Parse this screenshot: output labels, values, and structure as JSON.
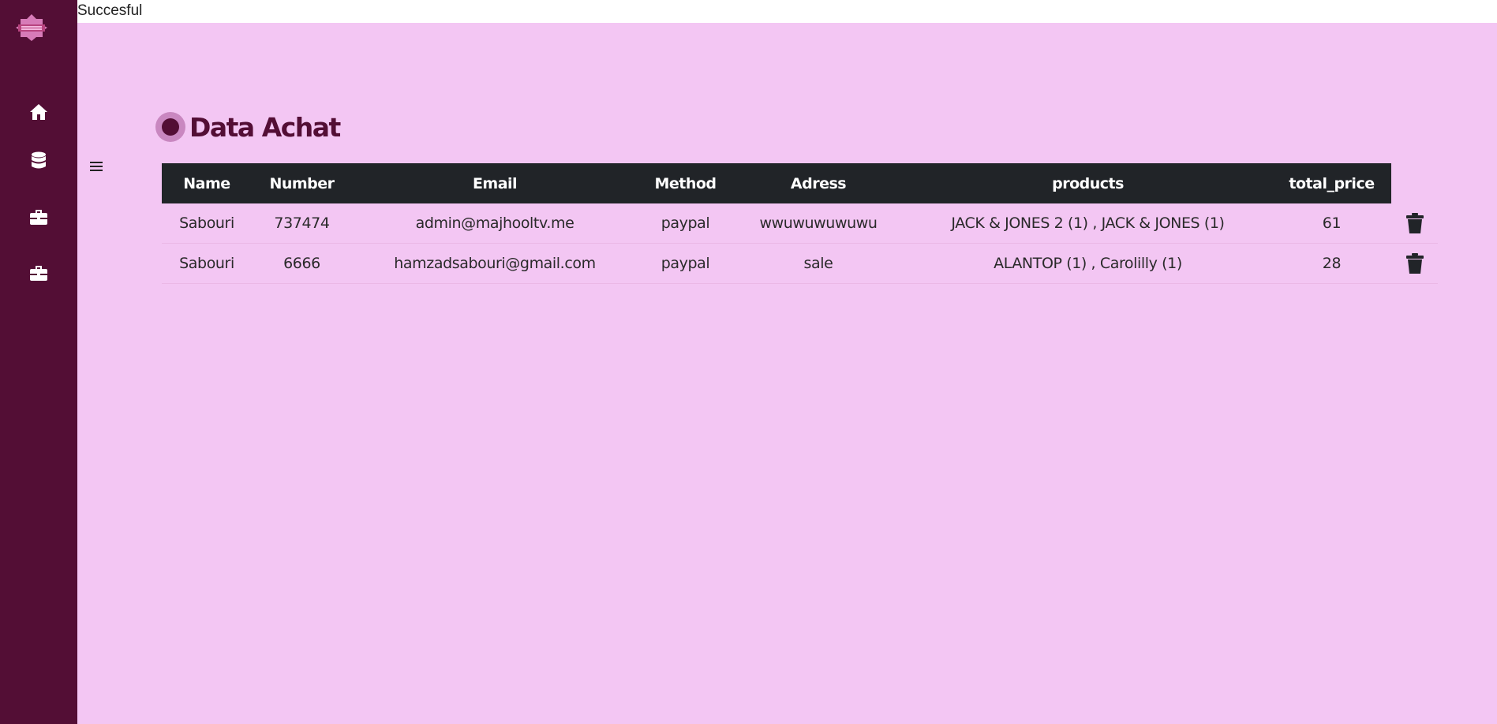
{
  "topbar": {
    "status": "Succesful"
  },
  "sidebar": {
    "items": [
      {
        "icon": "home-icon"
      },
      {
        "icon": "database-icon"
      },
      {
        "icon": "briefcase-icon"
      },
      {
        "icon": "briefcase-icon"
      }
    ]
  },
  "page": {
    "title": "Data Achat"
  },
  "table": {
    "columns": [
      "Name",
      "Number",
      "Email",
      "Method",
      "Adress",
      "products",
      "total_price"
    ],
    "rows": [
      {
        "name": "Sabouri",
        "number": "737474",
        "email": "admin@majhooltv.me",
        "method": "paypal",
        "adress": "wwuwuwuwuwu",
        "products": "JACK & JONES 2 (1) , JACK & JONES (1)",
        "total_price": "61"
      },
      {
        "name": "Sabouri",
        "number": "6666",
        "email": "hamzadsabouri@gmail.com",
        "method": "paypal",
        "adress": "sale",
        "products": "ALANTOP (1) , Carolilly (1)",
        "total_price": "28"
      }
    ]
  },
  "colors": {
    "sidebar_bg": "#530e35",
    "page_bg": "#f3c6f3",
    "table_header_bg": "#212428",
    "title_color": "#530e35"
  }
}
